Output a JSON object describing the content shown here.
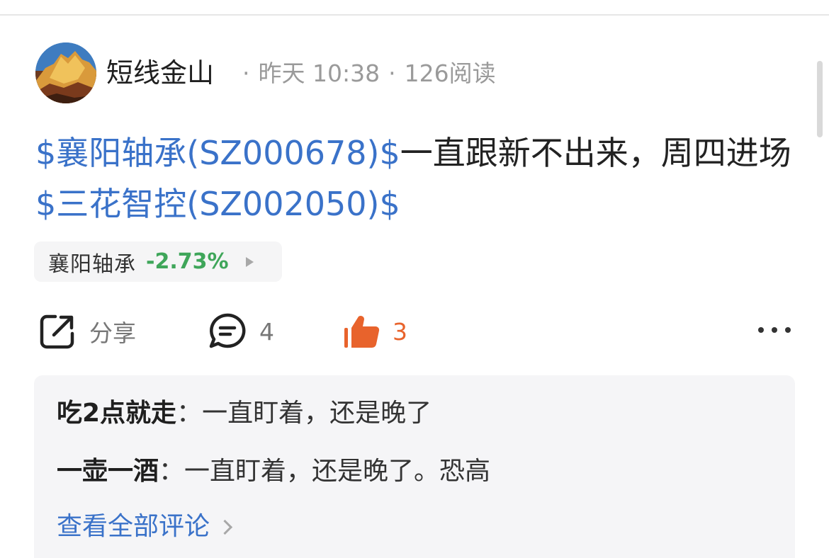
{
  "post": {
    "author": "短线金山",
    "time": "昨天 10:38",
    "reads": "126阅读",
    "dot": "·",
    "text_segments": [
      {
        "text": "$襄阳轴承(SZ000678)$",
        "type": "stock"
      },
      {
        "text": "一直跟新不出来，周四进场",
        "type": "plain"
      },
      {
        "text": "$三花智控(SZ002050)$",
        "type": "stock"
      }
    ]
  },
  "stock_chip": {
    "name": "襄阳轴承",
    "change": "-2.73%",
    "change_color": "#3fa65a"
  },
  "actions": {
    "share_label": "分享",
    "comment_count": "4",
    "like_count": "3",
    "like_color": "#e8632c"
  },
  "comments": {
    "items": [
      {
        "author": "吃2点就走",
        "separator": "：",
        "text": "一直盯着，还是晚了"
      },
      {
        "author": "一壶一酒",
        "separator": "：",
        "text": "一直盯着，还是晚了。恐高"
      }
    ],
    "view_all_label": "查看全部评论"
  },
  "colors": {
    "link_blue": "#3a72c9",
    "text_dark": "#222222",
    "meta_gray": "#9a9a9a"
  }
}
